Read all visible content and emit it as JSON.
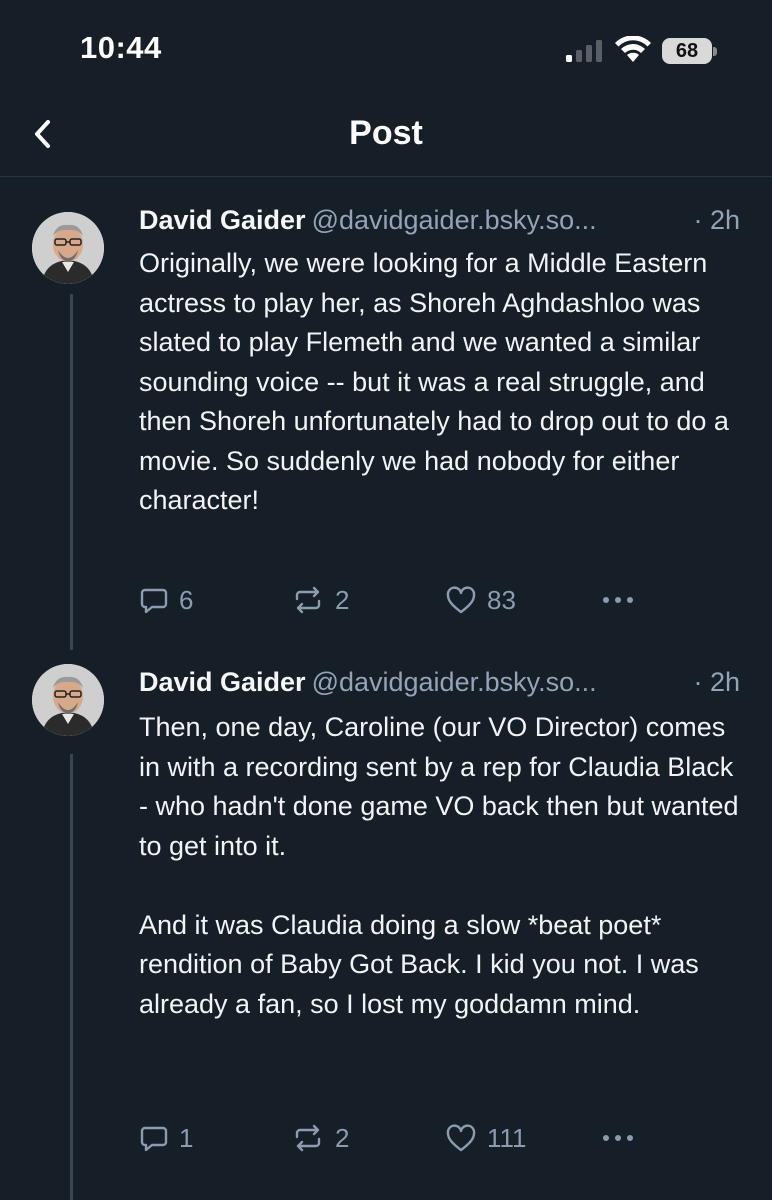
{
  "status_bar": {
    "time": "10:44",
    "battery": "68"
  },
  "header": {
    "title": "Post"
  },
  "posts": [
    {
      "author": "David Gaider",
      "handle": "@davidgaider.bsky.so...",
      "time": "· 2h",
      "text": "Originally, we were looking for a Middle Eastern actress to play her, as Shoreh Aghdashloo was slated to play Flemeth and we wanted a similar sounding voice -- but it was a real struggle, and then Shoreh unfortunately had to drop out to do a movie. So suddenly we had nobody for either character!",
      "replies": "6",
      "reposts": "2",
      "likes": "83"
    },
    {
      "author": "David Gaider",
      "handle": "@davidgaider.bsky.so...",
      "time": "· 2h",
      "text": "Then, one day, Caroline (our VO Director) comes in with a recording sent by a rep for Claudia Black - who hadn't done game VO back then but wanted to get into it.\n\nAnd it was Claudia doing a slow *beat poet* rendition of Baby Got Back. I kid you not. I was already a fan, so I lost my goddamn mind.",
      "replies": "1",
      "reposts": "2",
      "likes": "111"
    }
  ],
  "colors": {
    "background": "#161e27",
    "text": "#f1f3f5",
    "muted": "#94a3b8",
    "icon": "#8b9bb0",
    "thread_line": "#3a4552"
  },
  "icons": {
    "back": "chevron-left-icon",
    "reply": "speech-bubble-icon",
    "repost": "repost-arrows-icon",
    "like": "heart-outline-icon",
    "more": "ellipsis-icon"
  }
}
